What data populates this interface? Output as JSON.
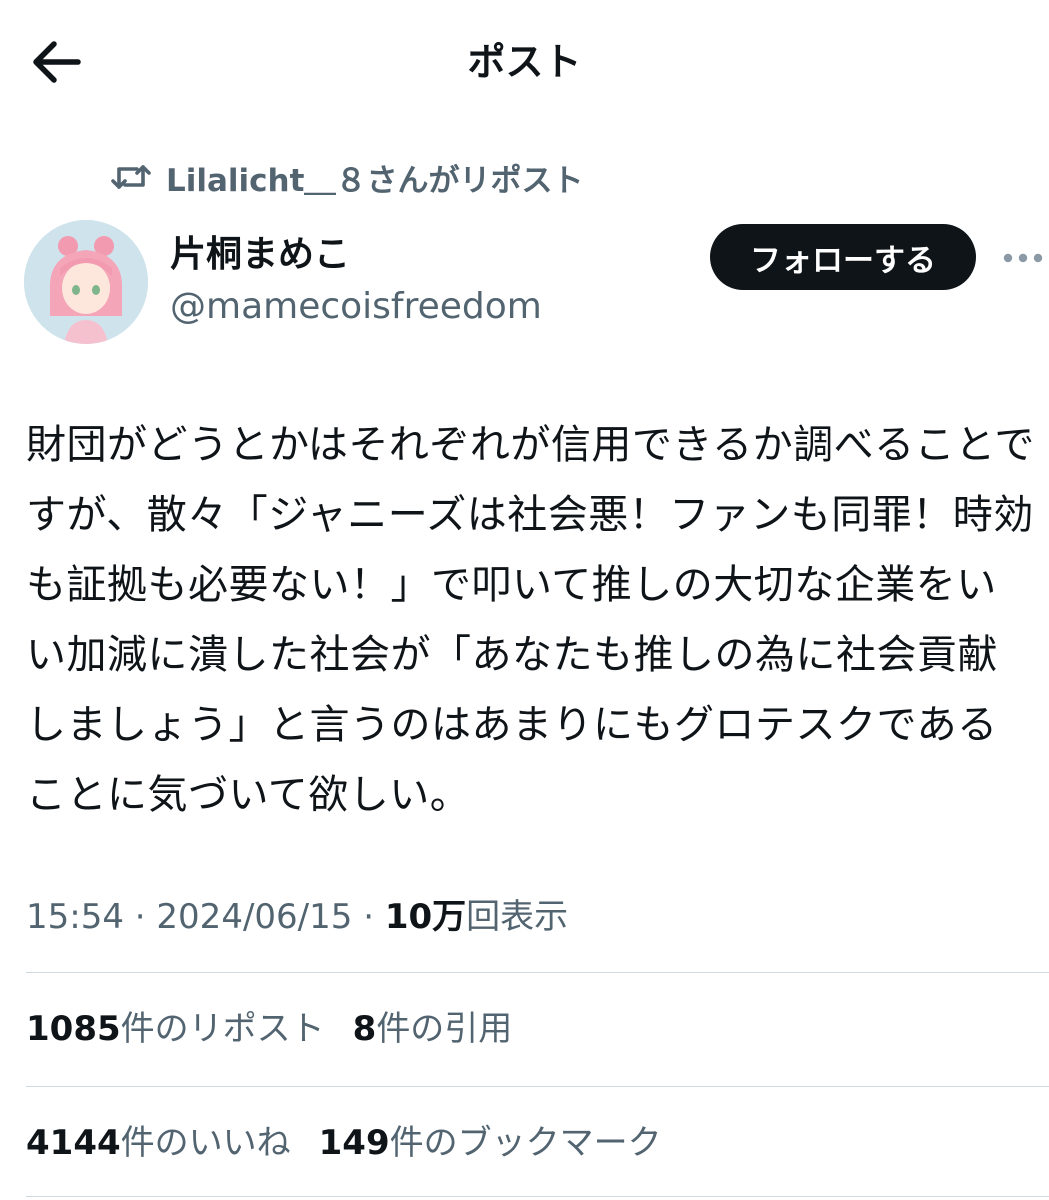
{
  "header": {
    "title": "ポスト",
    "back_icon": "arrow-left-icon"
  },
  "repost_context": {
    "icon": "repost-icon",
    "text": "Lilalicht＿８さんがリポスト"
  },
  "author": {
    "display_name": "片桐まめこ",
    "handle": "@mamecoisfreedom",
    "avatar": "avatar-anime-girl-pink-hair"
  },
  "follow_button": {
    "label": "フォローする"
  },
  "more_icon": "more-horizontal-icon",
  "post": {
    "text": "財団がどうとかはそれぞれが信用できるか調べることですが、散々「ジャニーズは社会悪！ファンも同罪！時効も証拠も必要ない！」で叩いて推しの大切な企業をいい加減に潰した社会が「あなたも推しの為に社会貢献しましょう」と言うのはあまりにもグロテスクであることに気づいて欲しい。"
  },
  "meta": {
    "time": "15:54",
    "date": "2024/06/15",
    "separator": " · ",
    "views_count": "10万",
    "views_label": "回表示"
  },
  "stats": {
    "reposts_count": "1085",
    "reposts_label": "件のリポスト",
    "quotes_count": "8",
    "quotes_label": "件の引用",
    "likes_count": "4144",
    "likes_label": "件のいいね",
    "bookmarks_count": "149",
    "bookmarks_label": "件のブックマーク"
  },
  "colors": {
    "text": "#0f1419",
    "secondary": "#536471",
    "button_bg": "#0f1419",
    "divider": "#cfd9de"
  }
}
